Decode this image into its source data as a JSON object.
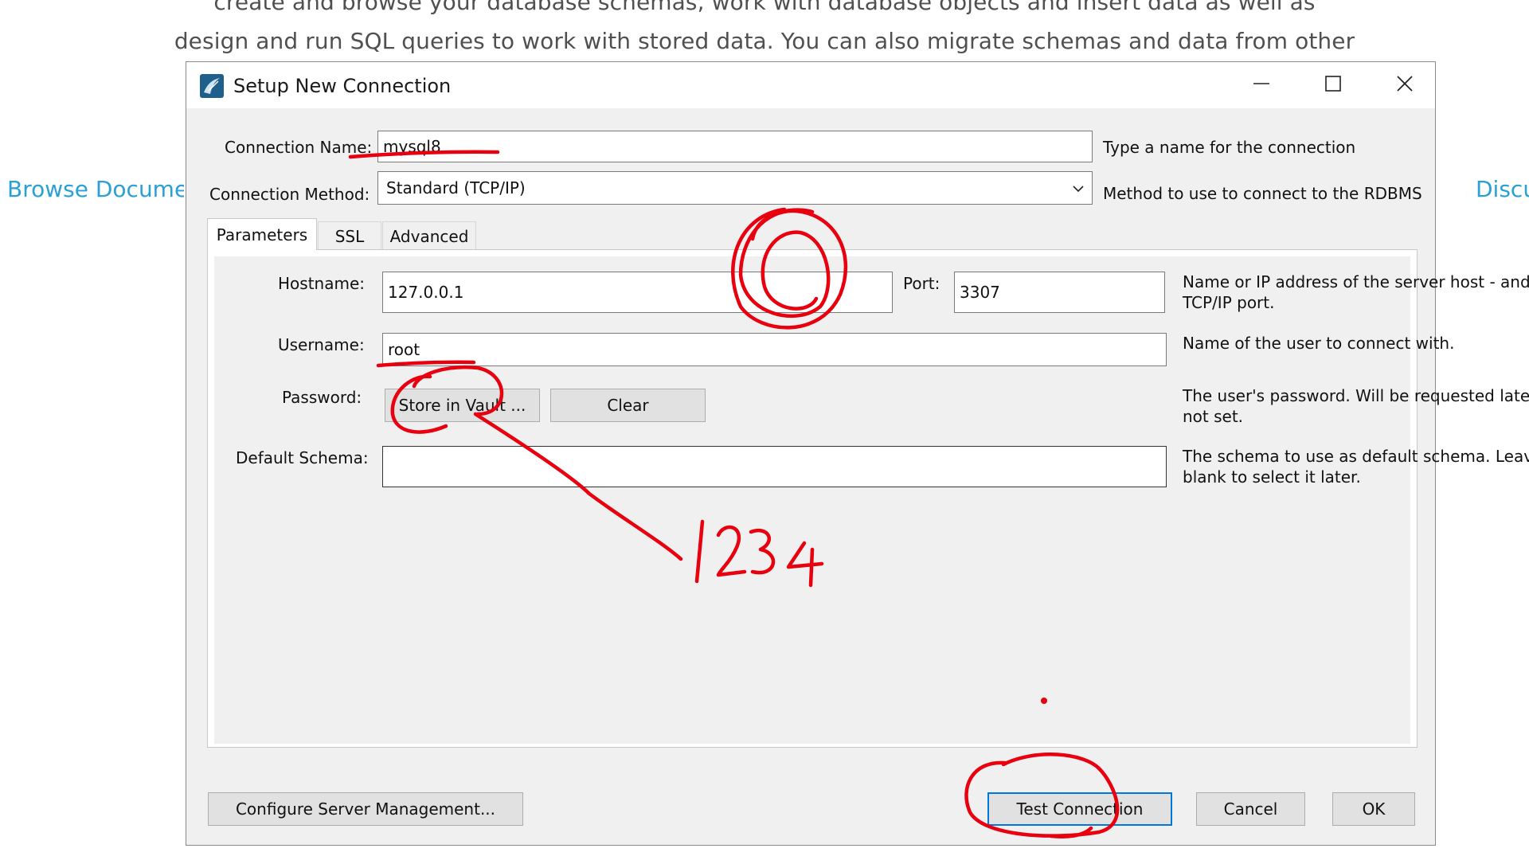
{
  "background": {
    "line1": "create and browse your database schemas, work with database objects and insert data as well as",
    "line2": "design and run SQL queries to work with stored data. You can also migrate schemas and data from other",
    "link_left": "Browse Documentation",
    "link_right": "Discuss"
  },
  "window": {
    "title": "Setup New Connection",
    "controls": {
      "minimize": "minimize-icon",
      "maximize": "maximize-icon",
      "close": "close-icon"
    }
  },
  "connection": {
    "name_label": "Connection Name:",
    "name_value": "mysql8",
    "name_hint": "Type a name for the connection",
    "method_label": "Connection Method:",
    "method_value": "Standard (TCP/IP)",
    "method_hint": "Method to use to connect to the RDBMS"
  },
  "tabs": [
    {
      "label": "Parameters",
      "active": true
    },
    {
      "label": "SSL",
      "active": false
    },
    {
      "label": "Advanced",
      "active": false
    }
  ],
  "parameters": {
    "hostname_label": "Hostname:",
    "hostname_value": "127.0.0.1",
    "port_label": "Port:",
    "port_value": "3307",
    "host_hint": "Name or IP address of the server host - and TCP/IP port.",
    "username_label": "Username:",
    "username_value": "root",
    "username_hint": "Name of the user to connect with.",
    "password_label": "Password:",
    "store_vault_label": "Store in Vault ...",
    "clear_label": "Clear",
    "password_hint": "The user's password. Will be requested later if it's not set.",
    "schema_label": "Default Schema:",
    "schema_value": "",
    "schema_hint": "The schema to use as default schema. Leave blank to select it later."
  },
  "footer": {
    "configure_label": "Configure Server Management...",
    "test_label": "Test Connection",
    "cancel_label": "Cancel",
    "ok_label": "OK"
  },
  "annotation": {
    "handwritten_text": "1234",
    "ink_color": "#e8000f"
  },
  "colors": {
    "link": "#2aa0d4",
    "default_button_border": "#0078d7",
    "dialog_bg": "#f0f0f0"
  }
}
